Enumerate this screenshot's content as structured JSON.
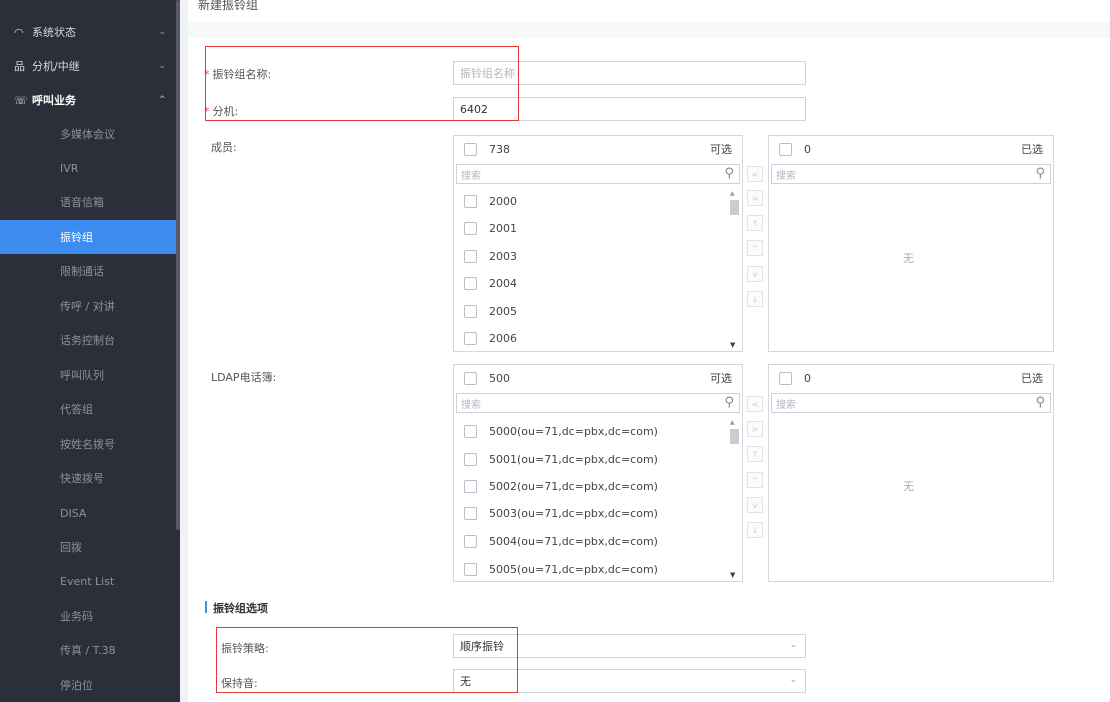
{
  "sidebar": {
    "top_items": [
      {
        "label": "系统状态",
        "icon": "gauge-icon",
        "state": "collapsed"
      },
      {
        "label": "分机/中继",
        "icon": "network-icon",
        "state": "collapsed"
      },
      {
        "label": "呼叫业务",
        "icon": "phone-call-icon",
        "state": "expanded"
      }
    ],
    "sub_items": [
      {
        "label": "多媒体会议"
      },
      {
        "label": "IVR"
      },
      {
        "label": "语音信箱"
      },
      {
        "label": "振铃组",
        "active": true
      },
      {
        "label": "限制通话"
      },
      {
        "label": "传呼 / 对讲"
      },
      {
        "label": "话务控制台"
      },
      {
        "label": "呼叫队列"
      },
      {
        "label": "代答组"
      },
      {
        "label": "按姓名拨号"
      },
      {
        "label": "快速拨号"
      },
      {
        "label": "DISA"
      },
      {
        "label": "回拨"
      },
      {
        "label": "Event List"
      },
      {
        "label": "业务码"
      },
      {
        "label": "传真 / T.38"
      },
      {
        "label": "停泊位"
      }
    ]
  },
  "page": {
    "title": "新建振铃组"
  },
  "form": {
    "name": {
      "required": "*",
      "label": "振铃组名称:",
      "placeholder": "振铃组名称",
      "value": ""
    },
    "extension": {
      "required": "*",
      "label": "分机:",
      "value": "6402"
    },
    "members": {
      "label": "成员:",
      "available": {
        "count": "738",
        "kind": "可选",
        "search_placeholder": "搜索",
        "items": [
          "2000",
          "2001",
          "2003",
          "2004",
          "2005",
          "2006"
        ]
      },
      "selected": {
        "count": "0",
        "kind": "已选",
        "search_placeholder": "搜索",
        "empty": "无"
      }
    },
    "ldap": {
      "label": "LDAP电话簿:",
      "available": {
        "count": "500",
        "kind": "可选",
        "search_placeholder": "搜索",
        "items": [
          "5000(ou=71,dc=pbx,dc=com)",
          "5001(ou=71,dc=pbx,dc=com)",
          "5002(ou=71,dc=pbx,dc=com)",
          "5003(ou=71,dc=pbx,dc=com)",
          "5004(ou=71,dc=pbx,dc=com)",
          "5005(ou=71,dc=pbx,dc=com)"
        ]
      },
      "selected": {
        "count": "0",
        "kind": "已选",
        "search_placeholder": "搜索",
        "empty": "无"
      }
    },
    "transfer_buttons": [
      ">",
      "↑",
      "^",
      "v",
      "↓",
      "<"
    ],
    "options": {
      "section_title": "振铃组选项",
      "strategy": {
        "label": "振铃策略:",
        "value": "顺序振铃"
      },
      "moh": {
        "label": "保持音:",
        "value": "无"
      }
    }
  },
  "colors": {
    "accent": "#3c8cf0",
    "highlight_box": "#e03a3a",
    "sidebar_bg": "#2b2f3a"
  }
}
